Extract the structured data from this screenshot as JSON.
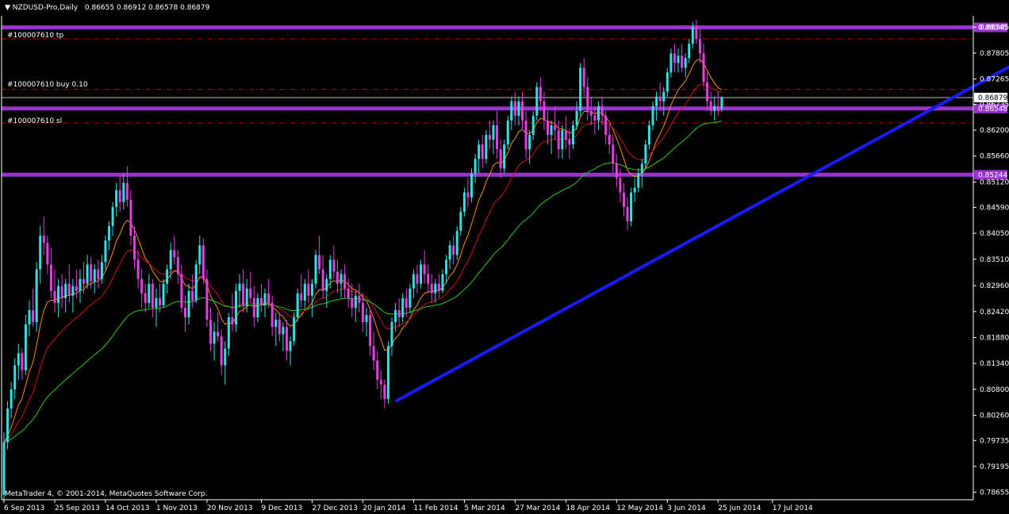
{
  "header": {
    "symbol": "NZDUSD-Pro,Daily",
    "ohlc": "0.86655 0.86912 0.86578 0.86879"
  },
  "copyright": "MetaTrader 4, © 2001-2014, MetaQuotes Software Corp.",
  "order_labels": {
    "tp": "#100007610 tp",
    "buy": "#100007610 buy 0.10",
    "sl": "#100007610 sl"
  },
  "colors": {
    "background": "#000000",
    "bull": "#33e0e0",
    "bear": "#e040e0",
    "ma_fast": "#ff8c00",
    "ma_mid": "#cc1414",
    "ma_slow": "#22cc22",
    "horizontal_levels": "#9933cc",
    "trendline": "#1a1aff",
    "order_lines": "#cc0000",
    "current_price_line": "#c0c0c0"
  },
  "chart_data": {
    "type": "candlestick",
    "ylim": [
      0.785,
      0.8858
    ],
    "price_ticks": [
      "0.88345",
      "0.87805",
      "0.87265",
      "0.86735",
      "0.86200",
      "0.85660",
      "0.85120",
      "0.84590",
      "0.84050",
      "0.83510",
      "0.82960",
      "0.82420",
      "0.81880",
      "0.81340",
      "0.80800",
      "0.80260",
      "0.79735",
      "0.79195",
      "0.78655"
    ],
    "date_ticks": [
      "6 Sep 2013",
      "25 Sep 2013",
      "14 Oct 2013",
      "1 Nov 2013",
      "20 Nov 2013",
      "9 Dec 2013",
      "27 Dec 2013",
      "20 Jan 2014",
      "11 Feb 2014",
      "5 Mar 2014",
      "27 Mar 2014",
      "18 Apr 2014",
      "12 May 2014",
      "3 Jun 2014",
      "25 Jun 2014",
      "17 Jul 2014"
    ],
    "current_price": "0.86879",
    "horizontal_levels": [
      {
        "price": 0.8834,
        "label": "0.88345"
      },
      {
        "price": 0.8665,
        "label": "0.86548"
      },
      {
        "price": 0.8527,
        "label": "0.85244"
      }
    ],
    "order_lines": [
      {
        "price": 0.881,
        "label_key": "tp"
      },
      {
        "price": 0.8705,
        "label_key": "buy"
      },
      {
        "price": 0.8635,
        "label_key": "sl"
      }
    ],
    "trendline": {
      "from": {
        "bar": 108,
        "price": 0.8055
      },
      "to": {
        "bar": 300,
        "price": 0.8845
      }
    },
    "ohlc": [
      [
        0.786,
        0.799,
        0.785,
        0.797
      ],
      [
        0.797,
        0.8055,
        0.7955,
        0.804
      ],
      [
        0.804,
        0.8095,
        0.802,
        0.808
      ],
      [
        0.808,
        0.8145,
        0.806,
        0.813
      ],
      [
        0.813,
        0.8175,
        0.81,
        0.8155
      ],
      [
        0.8155,
        0.8165,
        0.81,
        0.812
      ],
      [
        0.812,
        0.8235,
        0.811,
        0.8215
      ],
      [
        0.8215,
        0.8265,
        0.819,
        0.8245
      ],
      [
        0.8245,
        0.829,
        0.821,
        0.822
      ],
      [
        0.822,
        0.8345,
        0.82,
        0.833
      ],
      [
        0.833,
        0.842,
        0.83,
        0.84
      ],
      [
        0.84,
        0.844,
        0.836,
        0.8385
      ],
      [
        0.8385,
        0.84,
        0.832,
        0.834
      ],
      [
        0.834,
        0.8375,
        0.827,
        0.8285
      ],
      [
        0.8285,
        0.833,
        0.824,
        0.826
      ],
      [
        0.826,
        0.831,
        0.823,
        0.8295
      ],
      [
        0.8295,
        0.832,
        0.825,
        0.827
      ],
      [
        0.827,
        0.831,
        0.824,
        0.83
      ],
      [
        0.83,
        0.834,
        0.826,
        0.8275
      ],
      [
        0.8275,
        0.831,
        0.824,
        0.8295
      ],
      [
        0.8295,
        0.833,
        0.827,
        0.8285
      ],
      [
        0.8285,
        0.833,
        0.826,
        0.831
      ],
      [
        0.831,
        0.8345,
        0.828,
        0.83
      ],
      [
        0.83,
        0.836,
        0.829,
        0.834
      ],
      [
        0.834,
        0.8355,
        0.829,
        0.8305
      ],
      [
        0.8305,
        0.834,
        0.828,
        0.833
      ],
      [
        0.833,
        0.835,
        0.829,
        0.831
      ],
      [
        0.831,
        0.836,
        0.83,
        0.8345
      ],
      [
        0.8345,
        0.84,
        0.833,
        0.839
      ],
      [
        0.839,
        0.843,
        0.837,
        0.842
      ],
      [
        0.842,
        0.847,
        0.84,
        0.846
      ],
      [
        0.846,
        0.851,
        0.844,
        0.8495
      ],
      [
        0.8495,
        0.8525,
        0.845,
        0.847
      ],
      [
        0.847,
        0.853,
        0.8455,
        0.851
      ],
      [
        0.851,
        0.8545,
        0.846,
        0.8475
      ],
      [
        0.8475,
        0.8495,
        0.838,
        0.84
      ],
      [
        0.84,
        0.842,
        0.833,
        0.835
      ],
      [
        0.835,
        0.837,
        0.829,
        0.831
      ],
      [
        0.831,
        0.833,
        0.825,
        0.828
      ],
      [
        0.828,
        0.83,
        0.824,
        0.826
      ],
      [
        0.826,
        0.832,
        0.825,
        0.83
      ],
      [
        0.83,
        0.831,
        0.823,
        0.825
      ],
      [
        0.825,
        0.829,
        0.821,
        0.827
      ],
      [
        0.827,
        0.83,
        0.824,
        0.8255
      ],
      [
        0.8255,
        0.831,
        0.825,
        0.83
      ],
      [
        0.83,
        0.834,
        0.828,
        0.833
      ],
      [
        0.833,
        0.8385,
        0.831,
        0.837
      ],
      [
        0.837,
        0.84,
        0.834,
        0.8355
      ],
      [
        0.8355,
        0.837,
        0.83,
        0.832
      ],
      [
        0.832,
        0.834,
        0.824,
        0.825
      ],
      [
        0.825,
        0.8275,
        0.82,
        0.823
      ],
      [
        0.823,
        0.83,
        0.8215,
        0.8285
      ],
      [
        0.8285,
        0.832,
        0.825,
        0.8265
      ],
      [
        0.8265,
        0.835,
        0.826,
        0.834
      ],
      [
        0.834,
        0.84,
        0.832,
        0.838
      ],
      [
        0.838,
        0.8395,
        0.83,
        0.831
      ],
      [
        0.831,
        0.833,
        0.821,
        0.8225
      ],
      [
        0.8225,
        0.825,
        0.816,
        0.8175
      ],
      [
        0.8175,
        0.822,
        0.814,
        0.82
      ],
      [
        0.82,
        0.824,
        0.818,
        0.819
      ],
      [
        0.819,
        0.8205,
        0.811,
        0.813
      ],
      [
        0.813,
        0.818,
        0.809,
        0.8165
      ],
      [
        0.8165,
        0.824,
        0.815,
        0.823
      ],
      [
        0.823,
        0.828,
        0.82,
        0.8215
      ],
      [
        0.8215,
        0.83,
        0.82,
        0.8285
      ],
      [
        0.8285,
        0.832,
        0.825,
        0.83
      ],
      [
        0.83,
        0.833,
        0.824,
        0.8255
      ],
      [
        0.8255,
        0.831,
        0.824,
        0.829
      ],
      [
        0.829,
        0.8325,
        0.826,
        0.827
      ],
      [
        0.827,
        0.8295,
        0.821,
        0.823
      ],
      [
        0.823,
        0.828,
        0.822,
        0.827
      ],
      [
        0.827,
        0.83,
        0.824,
        0.8255
      ],
      [
        0.8255,
        0.829,
        0.823,
        0.828
      ],
      [
        0.828,
        0.831,
        0.825,
        0.826
      ],
      [
        0.826,
        0.8275,
        0.819,
        0.821
      ],
      [
        0.821,
        0.824,
        0.817,
        0.8225
      ],
      [
        0.8225,
        0.824,
        0.818,
        0.8195
      ],
      [
        0.8195,
        0.822,
        0.816,
        0.821
      ],
      [
        0.821,
        0.8225,
        0.814,
        0.816
      ],
      [
        0.816,
        0.819,
        0.813,
        0.818
      ],
      [
        0.818,
        0.824,
        0.817,
        0.823
      ],
      [
        0.823,
        0.829,
        0.822,
        0.828
      ],
      [
        0.828,
        0.832,
        0.825,
        0.8265
      ],
      [
        0.8265,
        0.831,
        0.825,
        0.83
      ],
      [
        0.83,
        0.833,
        0.826,
        0.8275
      ],
      [
        0.8275,
        0.831,
        0.823,
        0.83
      ],
      [
        0.83,
        0.837,
        0.829,
        0.836
      ],
      [
        0.836,
        0.84,
        0.832,
        0.833
      ],
      [
        0.833,
        0.836,
        0.827,
        0.8285
      ],
      [
        0.8285,
        0.832,
        0.825,
        0.831
      ],
      [
        0.831,
        0.836,
        0.829,
        0.835
      ],
      [
        0.835,
        0.838,
        0.831,
        0.8325
      ],
      [
        0.8325,
        0.835,
        0.828,
        0.83
      ],
      [
        0.83,
        0.833,
        0.827,
        0.832
      ],
      [
        0.832,
        0.834,
        0.827,
        0.829
      ],
      [
        0.829,
        0.831,
        0.825,
        0.827
      ],
      [
        0.827,
        0.83,
        0.823,
        0.825
      ],
      [
        0.825,
        0.8285,
        0.822,
        0.8275
      ],
      [
        0.8275,
        0.83,
        0.824,
        0.826
      ],
      [
        0.826,
        0.828,
        0.82,
        0.822
      ],
      [
        0.822,
        0.825,
        0.819,
        0.8235
      ],
      [
        0.8235,
        0.825,
        0.815,
        0.817
      ],
      [
        0.817,
        0.82,
        0.812,
        0.814
      ],
      [
        0.814,
        0.816,
        0.808,
        0.81
      ],
      [
        0.81,
        0.812,
        0.806,
        0.809
      ],
      [
        0.809,
        0.81,
        0.804,
        0.806
      ],
      [
        0.806,
        0.818,
        0.805,
        0.817
      ],
      [
        0.817,
        0.823,
        0.815,
        0.822
      ],
      [
        0.822,
        0.826,
        0.82,
        0.8245
      ],
      [
        0.8245,
        0.827,
        0.821,
        0.823
      ],
      [
        0.823,
        0.828,
        0.822,
        0.827
      ],
      [
        0.827,
        0.829,
        0.823,
        0.825
      ],
      [
        0.825,
        0.83,
        0.824,
        0.829
      ],
      [
        0.829,
        0.833,
        0.827,
        0.832
      ],
      [
        0.832,
        0.834,
        0.828,
        0.83
      ],
      [
        0.83,
        0.835,
        0.829,
        0.834
      ],
      [
        0.834,
        0.837,
        0.83,
        0.832
      ],
      [
        0.832,
        0.834,
        0.828,
        0.83
      ],
      [
        0.83,
        0.832,
        0.826,
        0.828
      ],
      [
        0.828,
        0.831,
        0.826,
        0.83
      ],
      [
        0.83,
        0.832,
        0.827,
        0.8285
      ],
      [
        0.8285,
        0.833,
        0.828,
        0.832
      ],
      [
        0.832,
        0.836,
        0.83,
        0.835
      ],
      [
        0.835,
        0.839,
        0.833,
        0.838
      ],
      [
        0.838,
        0.84,
        0.834,
        0.836
      ],
      [
        0.836,
        0.842,
        0.835,
        0.841
      ],
      [
        0.841,
        0.846,
        0.84,
        0.845
      ],
      [
        0.845,
        0.85,
        0.844,
        0.849
      ],
      [
        0.849,
        0.852,
        0.846,
        0.848
      ],
      [
        0.848,
        0.854,
        0.847,
        0.853
      ],
      [
        0.853,
        0.857,
        0.851,
        0.856
      ],
      [
        0.856,
        0.86,
        0.853,
        0.859
      ],
      [
        0.859,
        0.861,
        0.854,
        0.856
      ],
      [
        0.856,
        0.862,
        0.855,
        0.861
      ],
      [
        0.861,
        0.864,
        0.858,
        0.86
      ],
      [
        0.86,
        0.864,
        0.857,
        0.863
      ],
      [
        0.863,
        0.866,
        0.856,
        0.858
      ],
      [
        0.858,
        0.86,
        0.852,
        0.854
      ],
      [
        0.854,
        0.86,
        0.853,
        0.859
      ],
      [
        0.859,
        0.865,
        0.858,
        0.864
      ],
      [
        0.864,
        0.869,
        0.862,
        0.868
      ],
      [
        0.868,
        0.87,
        0.863,
        0.865
      ],
      [
        0.865,
        0.869,
        0.863,
        0.868
      ],
      [
        0.868,
        0.87,
        0.862,
        0.864
      ],
      [
        0.864,
        0.866,
        0.856,
        0.858
      ],
      [
        0.858,
        0.862,
        0.855,
        0.861
      ],
      [
        0.861,
        0.866,
        0.86,
        0.865
      ],
      [
        0.865,
        0.872,
        0.864,
        0.871
      ],
      [
        0.871,
        0.873,
        0.866,
        0.868
      ],
      [
        0.868,
        0.87,
        0.862,
        0.864
      ],
      [
        0.864,
        0.866,
        0.859,
        0.861
      ],
      [
        0.861,
        0.864,
        0.857,
        0.863
      ],
      [
        0.863,
        0.867,
        0.86,
        0.862
      ],
      [
        0.862,
        0.864,
        0.856,
        0.858
      ],
      [
        0.858,
        0.863,
        0.856,
        0.862
      ],
      [
        0.862,
        0.865,
        0.858,
        0.86
      ],
      [
        0.86,
        0.862,
        0.856,
        0.859
      ],
      [
        0.859,
        0.864,
        0.858,
        0.863
      ],
      [
        0.863,
        0.868,
        0.862,
        0.866
      ],
      [
        0.866,
        0.876,
        0.865,
        0.875
      ],
      [
        0.875,
        0.877,
        0.869,
        0.871
      ],
      [
        0.871,
        0.873,
        0.864,
        0.866
      ],
      [
        0.866,
        0.869,
        0.863,
        0.865
      ],
      [
        0.865,
        0.867,
        0.861,
        0.864
      ],
      [
        0.864,
        0.868,
        0.862,
        0.867
      ],
      [
        0.867,
        0.869,
        0.863,
        0.865
      ],
      [
        0.865,
        0.866,
        0.859,
        0.861
      ],
      [
        0.861,
        0.863,
        0.857,
        0.859
      ],
      [
        0.859,
        0.861,
        0.853,
        0.855
      ],
      [
        0.855,
        0.857,
        0.85,
        0.852
      ],
      [
        0.852,
        0.854,
        0.847,
        0.849
      ],
      [
        0.849,
        0.851,
        0.844,
        0.846
      ],
      [
        0.846,
        0.848,
        0.841,
        0.843
      ],
      [
        0.843,
        0.85,
        0.842,
        0.849
      ],
      [
        0.849,
        0.852,
        0.847,
        0.85
      ],
      [
        0.85,
        0.854,
        0.849,
        0.853
      ],
      [
        0.853,
        0.856,
        0.85,
        0.855
      ],
      [
        0.855,
        0.86,
        0.854,
        0.859
      ],
      [
        0.859,
        0.864,
        0.858,
        0.863
      ],
      [
        0.863,
        0.868,
        0.862,
        0.867
      ],
      [
        0.867,
        0.87,
        0.864,
        0.869
      ],
      [
        0.869,
        0.872,
        0.866,
        0.868
      ],
      [
        0.868,
        0.871,
        0.865,
        0.87
      ],
      [
        0.87,
        0.875,
        0.869,
        0.874
      ],
      [
        0.874,
        0.879,
        0.873,
        0.878
      ],
      [
        0.878,
        0.88,
        0.874,
        0.876
      ],
      [
        0.876,
        0.879,
        0.874,
        0.8775
      ],
      [
        0.8775,
        0.88,
        0.874,
        0.875
      ],
      [
        0.875,
        0.878,
        0.873,
        0.877
      ],
      [
        0.877,
        0.881,
        0.876,
        0.88
      ],
      [
        0.88,
        0.8845,
        0.879,
        0.8835
      ],
      [
        0.8835,
        0.885,
        0.88,
        0.881
      ],
      [
        0.881,
        0.883,
        0.876,
        0.878
      ],
      [
        0.878,
        0.88,
        0.871,
        0.872
      ],
      [
        0.872,
        0.874,
        0.866,
        0.868
      ],
      [
        0.868,
        0.87,
        0.865,
        0.866
      ],
      [
        0.866,
        0.869,
        0.864,
        0.867
      ],
      [
        0.867,
        0.87,
        0.865,
        0.866
      ],
      [
        0.8665,
        0.8691,
        0.8658,
        0.8688
      ]
    ]
  }
}
